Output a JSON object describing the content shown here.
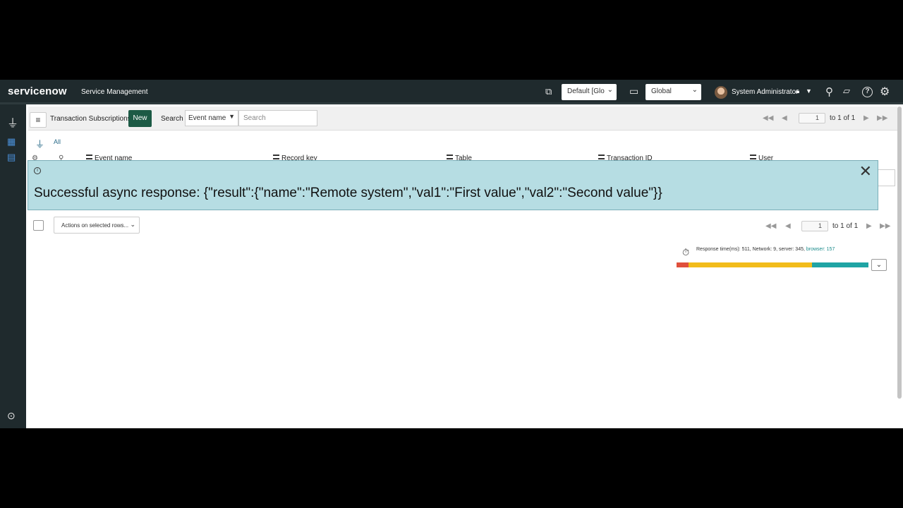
{
  "banner": {
    "logo_a": "service",
    "logo_b": "now",
    "product": "Service Management",
    "application_scope": "Default [Glo",
    "update_set": "Global",
    "user_name": "System Administrator",
    "icons": [
      "history-icon",
      "scope-icon",
      "lock-icon",
      "search-icon",
      "chat-icon",
      "help-icon",
      "gear-icon"
    ]
  },
  "list": {
    "title": "Transaction Subscriptions",
    "new_label": "New",
    "search_label": "Search",
    "search_field": "Event name",
    "search_placeholder": "Search",
    "page_value": "1",
    "page_text": "to 1 of 1",
    "breadcrumb": "All",
    "columns": [
      "Event name",
      "Record key",
      "Table",
      "Transaction ID",
      "User"
    ]
  },
  "notice": {
    "message": "Successful async response: {\"result\":{\"name\":\"Remote system\",\"val1\":\"First value\",\"val2\":\"Second value\"}}"
  },
  "footer": {
    "actions_label": "Actions on selected rows...",
    "page_value": "1",
    "page_text": "to 1 of 1"
  },
  "response": {
    "text": "Response time(ms): 511, Network: 9, server: 345, ",
    "browser": "browser: 157",
    "network_ms": 9,
    "server_ms": 345,
    "browser_ms": 157,
    "colors": {
      "network": "#e0503c",
      "server": "#f2bc1b",
      "browser": "#1fa4a4"
    }
  }
}
